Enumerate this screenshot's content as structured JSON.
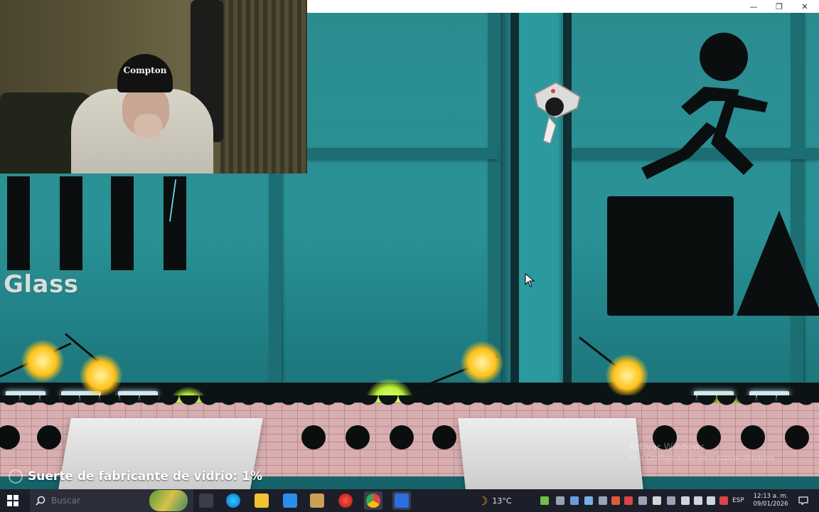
{
  "window": {
    "minimize": "—",
    "restore": "❐",
    "close": "✕"
  },
  "game": {
    "material_label": "Glass",
    "luck_text": "Suerte de fabricante de vidrio: 1%",
    "watermark": {
      "title": "Activar Windows",
      "subtitle": "Ve a Configuración para activar Windows."
    },
    "webcam_cap_text": "Compton",
    "colors": {
      "wall": "#2a9296",
      "yellow_light": "#ffc21a",
      "green_light": "#b8f036"
    }
  },
  "taskbar": {
    "search_placeholder": "Buscar",
    "weather": "13°C",
    "language": "ESP",
    "time": "12:13 a. m.",
    "date": "09/01/2026",
    "icons": [
      "windows-icon",
      "search-icon",
      "widget-icon",
      "task-view-icon",
      "edge-icon",
      "file-explorer-icon",
      "store-icon",
      "app-icon",
      "recorder-icon",
      "chrome-icon",
      "roblox-icon",
      "weather-icon",
      "notification-icon"
    ]
  }
}
